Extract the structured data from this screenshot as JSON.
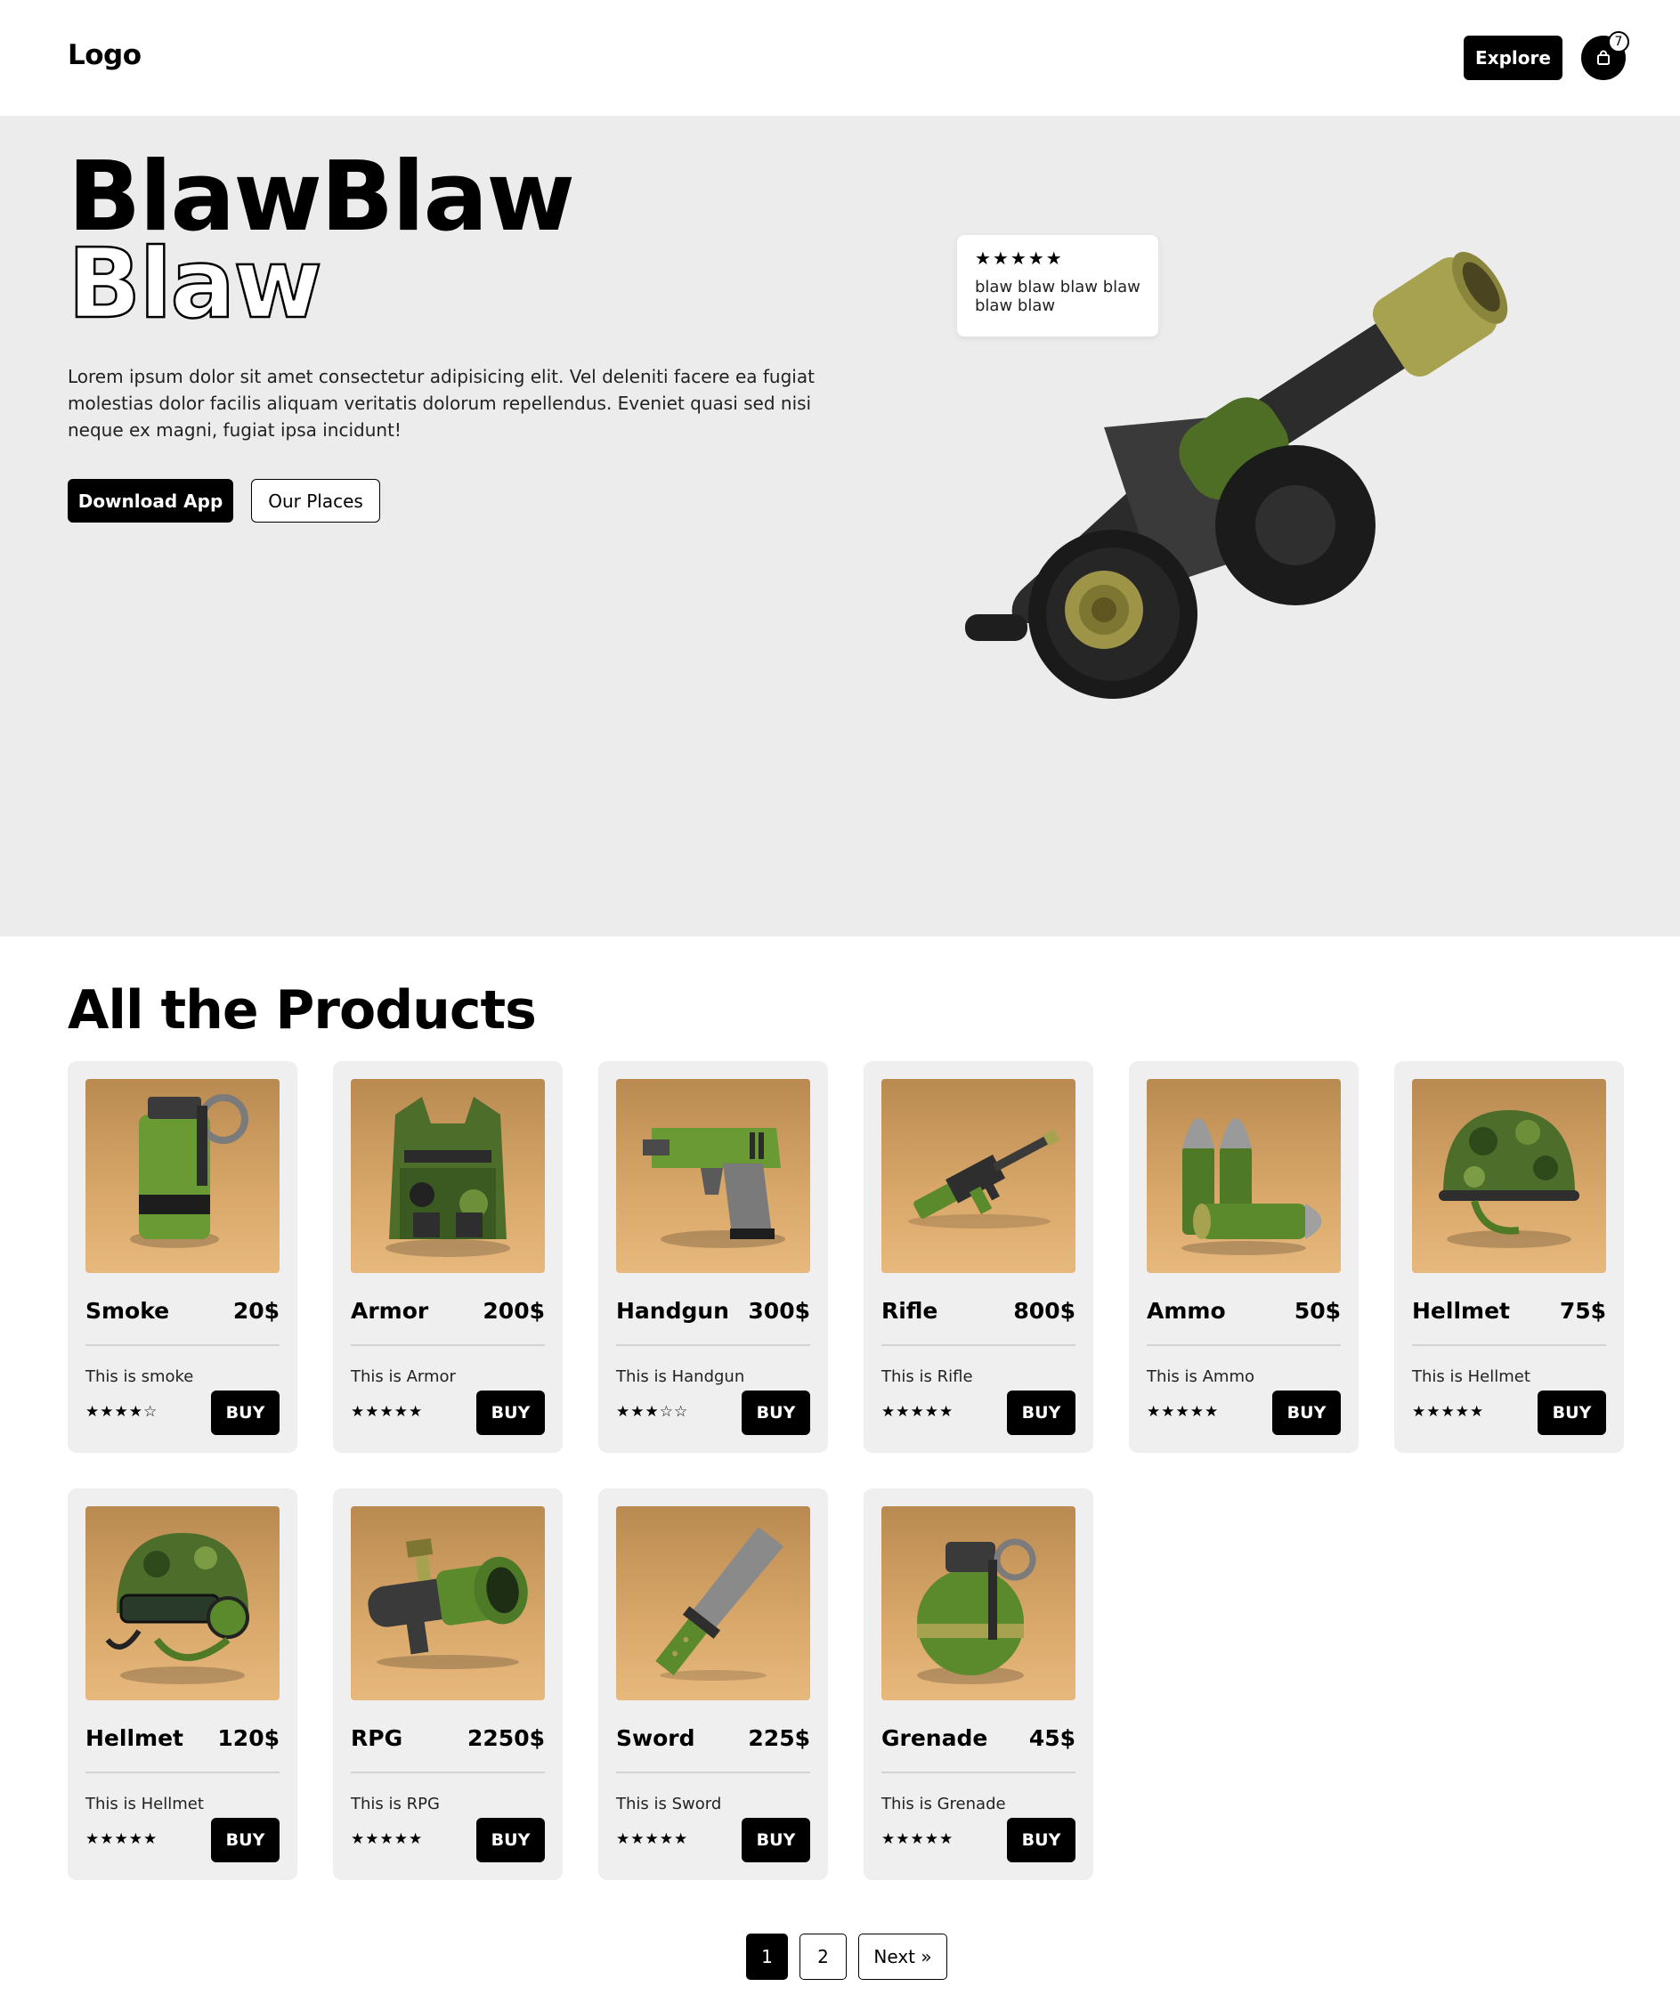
{
  "header": {
    "logo": "Logo",
    "explore_label": "Explore",
    "cart_count": "7",
    "cart_icon": "shopping-bag-icon"
  },
  "hero": {
    "title_line1": "BlawBlaw",
    "title_line2": "Blaw",
    "description": "Lorem ipsum dolor sit amet consectetur adipisicing elit. Vel deleniti facere ea fugiat molestias dolor facilis aliquam veritatis dolorum repellendus. Eveniet quasi sed nisi neque ex magni, fugiat ipsa incidunt!",
    "download_label": "Download App",
    "places_label": "Our Places",
    "review": {
      "stars": "★★★★★",
      "text": "blaw blaw blaw blaw blaw blaw"
    }
  },
  "products": {
    "title": "All the Products",
    "buy_label": "BUY",
    "items": [
      {
        "name": "Smoke",
        "price": "20$",
        "desc": "This is smoke",
        "stars": "★★★★☆",
        "icon": "smoke-grenade-icon"
      },
      {
        "name": "Armor",
        "price": "200$",
        "desc": "This is Armor",
        "stars": "★★★★★",
        "icon": "armor-vest-icon"
      },
      {
        "name": "Handgun",
        "price": "300$",
        "desc": "This is Handgun",
        "stars": "★★★☆☆",
        "icon": "handgun-icon"
      },
      {
        "name": "Rifle",
        "price": "800$",
        "desc": "This is Rifle",
        "stars": "★★★★★",
        "icon": "rifle-icon"
      },
      {
        "name": "Ammo",
        "price": "50$",
        "desc": "This is Ammo",
        "stars": "★★★★★",
        "icon": "ammo-icon"
      },
      {
        "name": "Hellmet",
        "price": "75$",
        "desc": "This is Hellmet",
        "stars": "★★★★★",
        "icon": "helmet-icon"
      },
      {
        "name": "Hellmet",
        "price": "120$",
        "desc": "This is Hellmet",
        "stars": "★★★★★",
        "icon": "helmet-headset-icon"
      },
      {
        "name": "RPG",
        "price": "2250$",
        "desc": "This is RPG",
        "stars": "★★★★★",
        "icon": "rpg-icon"
      },
      {
        "name": "Sword",
        "price": "225$",
        "desc": "This is Sword",
        "stars": "★★★★★",
        "icon": "sword-icon"
      },
      {
        "name": "Grenade",
        "price": "45$",
        "desc": "This is Grenade",
        "stars": "★★★★★",
        "icon": "grenade-icon"
      }
    ]
  },
  "pagination": {
    "page1": "1",
    "page2": "2",
    "next": "Next »"
  },
  "colors": {
    "hero_bg": "#ececec",
    "card_bg": "#efefef",
    "card_image_bg": "#d9a86a",
    "accent": "#000000",
    "military_green": "#5b8a2c"
  }
}
